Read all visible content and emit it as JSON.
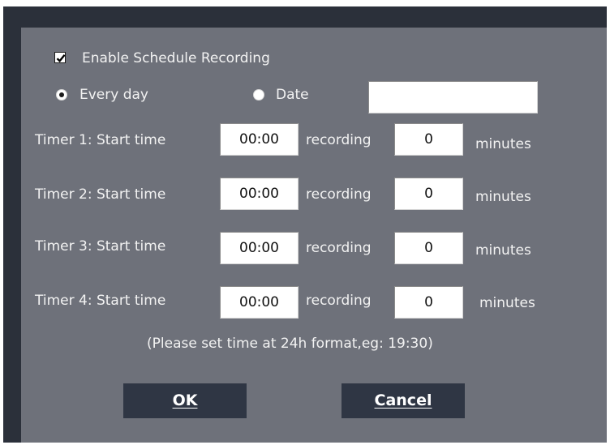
{
  "enable_schedule": {
    "label": "Enable Schedule Recording",
    "checked": true
  },
  "mode": {
    "every_day_label": "Every day",
    "date_label": "Date",
    "selected": "every_day",
    "date_value": ""
  },
  "timers": [
    {
      "label": "Timer 1: Start time",
      "start": "00:00",
      "recording_label": "recording",
      "minutes": "0",
      "minutes_label": "minutes"
    },
    {
      "label": "Timer 2: Start time",
      "start": "00:00",
      "recording_label": "recording",
      "minutes": "0",
      "minutes_label": "minutes"
    },
    {
      "label": "Timer 3: Start time",
      "start": "00:00",
      "recording_label": "recording",
      "minutes": "0",
      "minutes_label": "minutes"
    },
    {
      "label": "Timer 4: Start time",
      "start": "00:00",
      "recording_label": "recording",
      "minutes": "0",
      "minutes_label": "minutes"
    }
  ],
  "hint": "(Please set time at 24h format,eg: 19:30)",
  "buttons": {
    "ok": "OK",
    "cancel": "Cancel"
  },
  "colors": {
    "dialog_bg": "#6e717a",
    "frame_bg": "#2b303a",
    "button_bg": "#2f3644"
  }
}
